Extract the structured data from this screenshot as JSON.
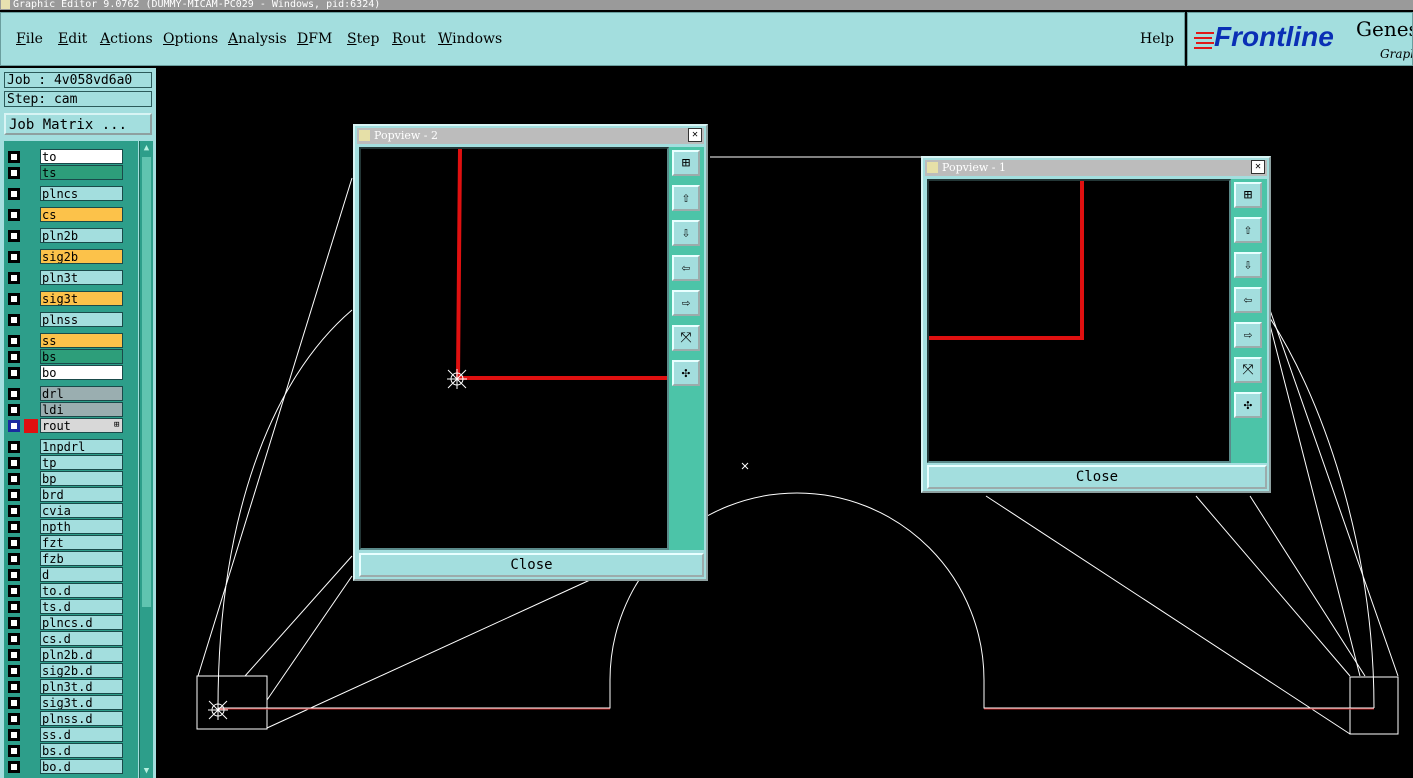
{
  "window_title": "Graphic Editor 9.0762 (DUMMY-MICAM-PC029 - Windows, pid:6324)",
  "menu": {
    "file": "File",
    "edit": "Edit",
    "actions": "Actions",
    "options": "Options",
    "analysis": "Analysis",
    "dfm": "DFM",
    "step": "Step",
    "rout": "Rout",
    "windows": "Windows",
    "help": "Help"
  },
  "logo": {
    "brand": "Frontline",
    "product": "Genesis",
    "sub": "Graphic"
  },
  "job": {
    "label": "Job : 4v058vd6a0",
    "step": "Step: cam",
    "matrix_button": "Job Matrix ..."
  },
  "layers": [
    {
      "name": "to",
      "color": "#ffffff"
    },
    {
      "name": "ts",
      "color": "#2d9e7a"
    },
    {
      "name": "plncs",
      "color": "#a3dede"
    },
    {
      "name": "cs",
      "color": "#fcc24a"
    },
    {
      "name": "pln2b",
      "color": "#a3dede"
    },
    {
      "name": "sig2b",
      "color": "#fcc24a"
    },
    {
      "name": "pln3t",
      "color": "#a3dede"
    },
    {
      "name": "sig3t",
      "color": "#fcc24a"
    },
    {
      "name": "plnss",
      "color": "#a3dede"
    },
    {
      "name": "ss",
      "color": "#fcc24a"
    },
    {
      "name": "bs",
      "color": "#2d9e7a"
    },
    {
      "name": "bo",
      "color": "#ffffff"
    },
    {
      "name": "drl",
      "color": "#9aaeb0"
    },
    {
      "name": "ldi",
      "color": "#9aaeb0"
    },
    {
      "name": "rout",
      "color": "#d8d8d8"
    },
    {
      "name": "1npdrl",
      "color": "#a3dede"
    },
    {
      "name": "tp",
      "color": "#a3dede"
    },
    {
      "name": "bp",
      "color": "#a3dede"
    },
    {
      "name": "brd",
      "color": "#a3dede"
    },
    {
      "name": "cvia",
      "color": "#a3dede"
    },
    {
      "name": "npth",
      "color": "#a3dede"
    },
    {
      "name": "fzt",
      "color": "#a3dede"
    },
    {
      "name": "fzb",
      "color": "#a3dede"
    },
    {
      "name": "d",
      "color": "#a3dede"
    },
    {
      "name": "to.d",
      "color": "#a3dede"
    },
    {
      "name": "ts.d",
      "color": "#a3dede"
    },
    {
      "name": "plncs.d",
      "color": "#a3dede"
    },
    {
      "name": "cs.d",
      "color": "#a3dede"
    },
    {
      "name": "pln2b.d",
      "color": "#a3dede"
    },
    {
      "name": "sig2b.d",
      "color": "#a3dede"
    },
    {
      "name": "pln3t.d",
      "color": "#a3dede"
    },
    {
      "name": "sig3t.d",
      "color": "#a3dede"
    },
    {
      "name": "plnss.d",
      "color": "#a3dede"
    },
    {
      "name": "ss.d",
      "color": "#a3dede"
    },
    {
      "name": "bs.d",
      "color": "#a3dede"
    },
    {
      "name": "bo.d",
      "color": "#a3dede"
    }
  ],
  "popview2": {
    "title": "Popview - 2",
    "close": "Close"
  },
  "popview1": {
    "title": "Popview - 1",
    "close": "Close"
  },
  "colors": {
    "panel": "#a3dede",
    "trace": "#e01010",
    "outline": "#ffffff"
  }
}
